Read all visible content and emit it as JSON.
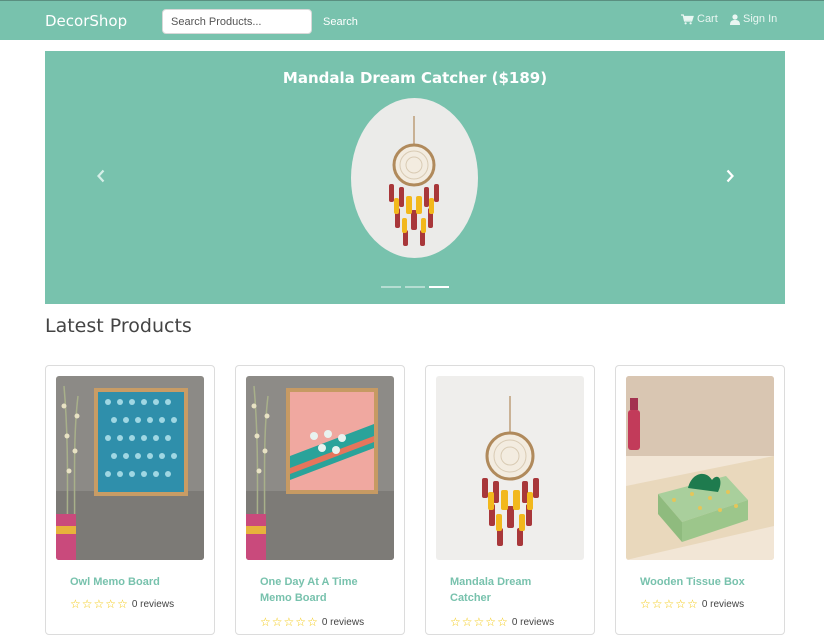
{
  "navbar": {
    "brand": "DecorShop",
    "search_placeholder": "Search Products...",
    "search_button": "Search",
    "cart_label": "Cart",
    "signin_label": "Sign In"
  },
  "carousel": {
    "caption": "Mandala Dream Catcher ($189)",
    "slide_count": 3,
    "active_slide": 3
  },
  "section_title": "Latest Products",
  "products": [
    {
      "name": "Owl Memo Board",
      "stars": 0,
      "reviews": "0 reviews"
    },
    {
      "name": "One Day At A Time Memo Board",
      "stars": 0,
      "reviews": "0 reviews"
    },
    {
      "name": "Mandala Dream Catcher",
      "stars": 0,
      "reviews": "0 reviews"
    },
    {
      "name": "Wooden Tissue Box",
      "stars": 0,
      "reviews": "0 reviews"
    }
  ],
  "colors": {
    "primary": "#78c2ad",
    "star": "#f3c80f"
  },
  "icons": [
    "cart-icon",
    "user-icon",
    "chevron-left-icon",
    "chevron-right-icon",
    "star-outline-icon"
  ]
}
